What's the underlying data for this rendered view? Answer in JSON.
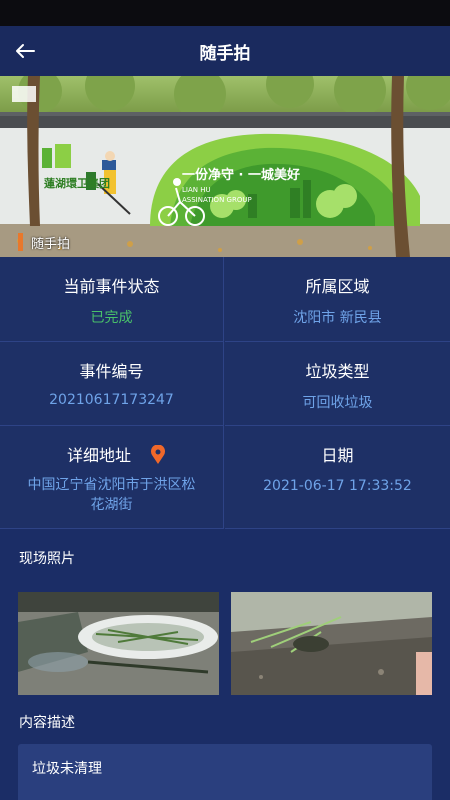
{
  "header": {
    "title": "随手拍"
  },
  "banner": {
    "caption": "随手拍",
    "logo_text": "蓮湖環卫集团",
    "slogan": "一份净守 · 一城美好",
    "slogan_sub": "LIAN HU",
    "slogan_sub2": "ASSINATION GROUP"
  },
  "info": {
    "status": {
      "label": "当前事件状态",
      "value": "已完成"
    },
    "region": {
      "label": "所属区域",
      "value": "沈阳市 新民县"
    },
    "event_no": {
      "label": "事件编号",
      "value": "20210617173247"
    },
    "garbage_type": {
      "label": "垃圾类型",
      "value": "可回收垃圾"
    },
    "address": {
      "label": "详细地址",
      "value_line1": "中国辽宁省沈阳市于洪区松",
      "value_line2": "花湖街"
    },
    "date": {
      "label": "日期",
      "value": "2021-06-17 17:33:52"
    }
  },
  "photos": {
    "title": "现场照片"
  },
  "description": {
    "title": "内容描述",
    "text": "垃圾未清理"
  },
  "colors": {
    "background": "#1b2d66",
    "value_blue": "#6fa3e8",
    "value_green": "#49c06a",
    "accent_orange": "#e8782c"
  }
}
